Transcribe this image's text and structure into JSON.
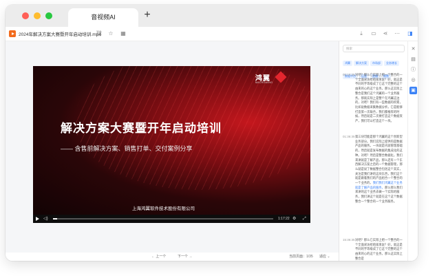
{
  "app": {
    "tab_title": "音视频AI",
    "new_tab": "+"
  },
  "file": {
    "name": "2024年解决方案大赛暨开年启动培训.mp4"
  },
  "video": {
    "logo_text": "鸿翼",
    "logo_sub": "MACROWING",
    "title": "解决方案大赛暨开年启动培训",
    "subtitle": "—— 含售前解决方案、销售打单、交付案例分享",
    "company": "上海鸿翼软件技术股份有限公司",
    "duration": "1:17:22",
    "progress": 0.02
  },
  "bottom": {
    "prev": "← 上一个",
    "next": "下一个 →",
    "page": "当前页面：1/35",
    "zoom": "适应 ⌄"
  },
  "panel": {
    "search_placeholder": "搜索",
    "tags": [
      "鸿翼",
      "解决方案",
      "市场部",
      "业务增长",
      "数据中台",
      "运营",
      "直播",
      "销售"
    ],
    "segments": [
      {
        "time": "00:10:35",
        "text": "对吧？那么它实际上把一个整合的一个全面采访给咱家来说？好，就这是不同的字等级成了它这个完整的这个由来的心的这个业务。那么这实际上整合是我们这个鸿翼的一个业务服务。那就实际上是整个在鸿翼这边的，对吧？我们有一些数据的积累，比如说数据采集数据分析，它是能够打造第一次联合，我们都推荐的时候，然后就是二次要打造这个数据资产，我们可以打造这个一块。"
      },
      {
        "time": "01:36:35",
        "text": "第三块可能是那个鸿翼的这个创新型业务部分。我们实际上提供的是数据产品的服务。一块就是内容管理基础的，然后就是发布数据的集成化的这种。对吧？然后是整合数据化，我们来讲就是了解产品，那么还有一个东西解决方案之后的一个数据管理，那么就是说了数据整合包括这个其实，关注是我们讲的这块东西，我们这个就是跟着我们的产品组合一个整合的一个业务的，",
        "highlight": "我们我们鸿翼这个业务就是了解产品的服务，",
        "text2": "那么那么我们来讲的这个业务去做一个实际的服务，我们讲这个就是在这个这个数据整合一个整合的一个业务服务。"
      },
      {
        "time": "15:36:35",
        "text": "对吧？那么它实际上把一个整合的一个全面采访给咱家来说？好，就这是不同的字等级成了它这个完整的这个由来的心的这个业务。那么这实际上整合是"
      }
    ]
  }
}
